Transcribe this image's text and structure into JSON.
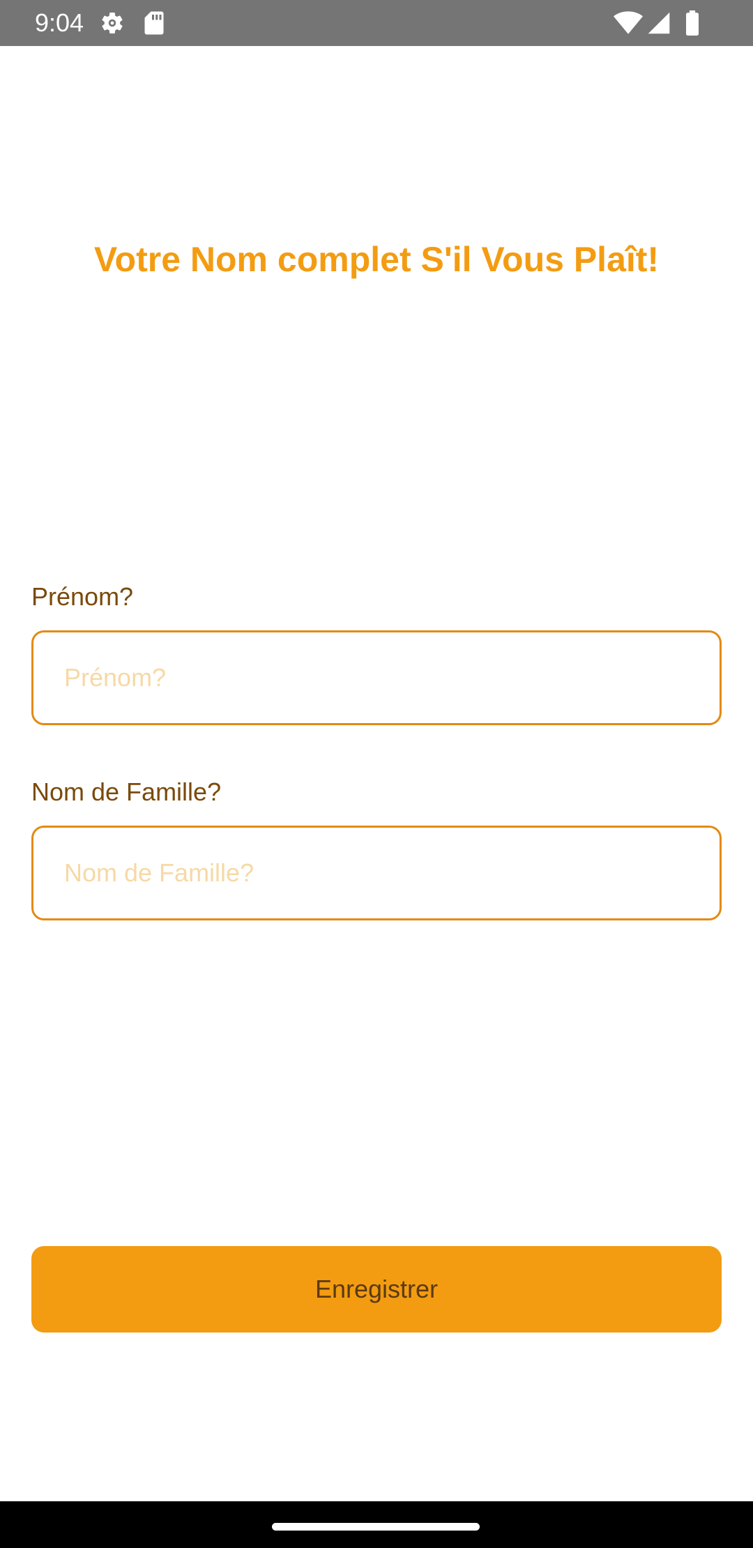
{
  "status_bar": {
    "time": "9:04",
    "icons": [
      "gear-icon",
      "sd-card-icon",
      "wifi-icon",
      "signal-icon",
      "battery-icon"
    ]
  },
  "header": {
    "title": "Votre Nom complet S'il Vous Plaît!"
  },
  "form": {
    "first_name": {
      "label": "Prénom?",
      "placeholder": "Prénom?",
      "value": ""
    },
    "last_name": {
      "label": "Nom de Famille?",
      "placeholder": "Nom de Famille?",
      "value": ""
    },
    "submit_label": "Enregistrer"
  },
  "colors": {
    "accent": "#F39C12",
    "label_text": "#7A4A0B",
    "input_border": "#E38A12",
    "placeholder": "#F6D9A6",
    "status_bar": "#757575",
    "nav_bar": "#000000"
  }
}
